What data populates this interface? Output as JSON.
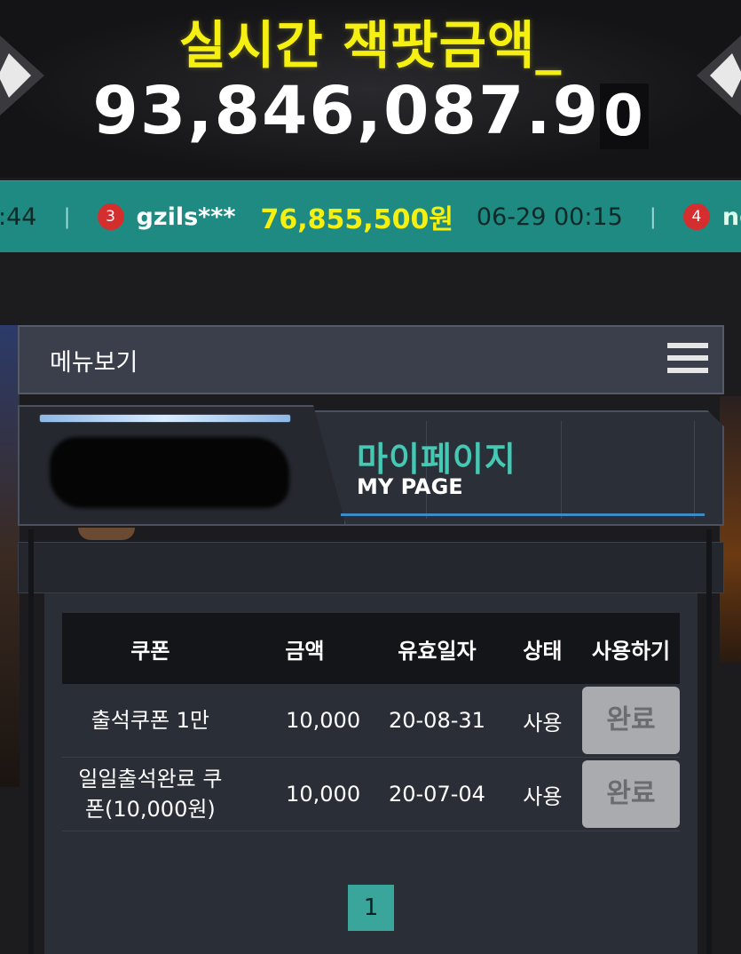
{
  "jackpot": {
    "title": "실시간 잭팟금액_",
    "amount_main": "93,846,087.9",
    "amount_last": "0"
  },
  "ticker": {
    "prev_time_fragment": ":44",
    "current": {
      "rank": "3",
      "user": "gzils***",
      "amount": "76,855,500원",
      "time": "06-29 00:15"
    },
    "next": {
      "rank": "4",
      "user_fragment": "ng"
    }
  },
  "menu": {
    "label": "메뉴보기",
    "icon": "hamburger-icon"
  },
  "mypage": {
    "title_ko": "마이페이지",
    "title_en": "MY PAGE"
  },
  "coupon_table": {
    "headers": [
      "쿠폰",
      "금액",
      "유효일자",
      "상태",
      "사용하기"
    ],
    "rows": [
      {
        "name": "출석쿠폰 1만",
        "amount": "10,000",
        "expiry": "20-08-31",
        "status": "사용",
        "action": "완료"
      },
      {
        "name": "일일출석완료 쿠폰(10,000원)",
        "name_line1": "일일출석완료 쿠",
        "name_line2": "폰(10,000원)",
        "amount": "10,000",
        "expiry": "20-07-04",
        "status": "사용",
        "action": "완료"
      }
    ]
  },
  "pagination": {
    "current_page": "1"
  },
  "colors": {
    "accent_yellow": "#f5f011",
    "teal": "#1f8a82",
    "mypage_teal": "#45c9b5",
    "background": "#1c1c1f"
  }
}
